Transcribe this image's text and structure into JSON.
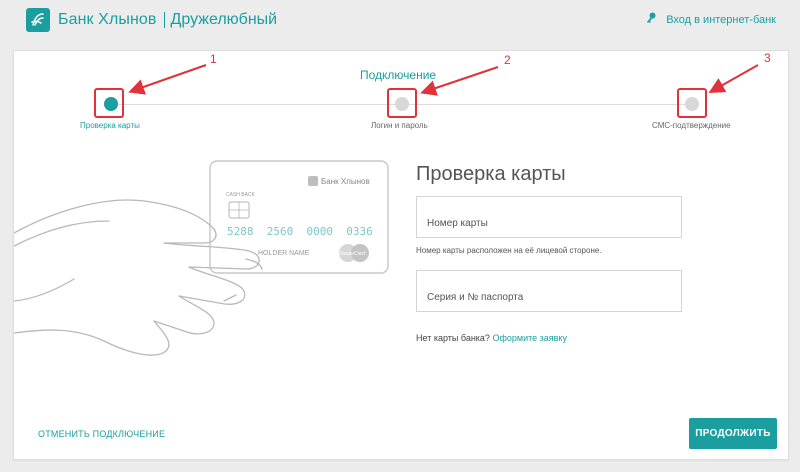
{
  "header": {
    "bank_name": "Банк Хлынов",
    "slogan": "Дружелюбный",
    "login_link": "Вход в интернет-банк"
  },
  "steps": {
    "title": "Подключение",
    "items": [
      {
        "label": "Проверка карты",
        "state": "active"
      },
      {
        "label": "Логин и пароль",
        "state": "inactive"
      },
      {
        "label": "СМС-подтверждение",
        "state": "inactive"
      }
    ]
  },
  "annotations": {
    "numbers": [
      "1",
      "2",
      "3"
    ]
  },
  "card": {
    "brand": "Банк Хлынов",
    "cashback": "CASH BACK",
    "number": "5288  2560  0000  0336",
    "holder": "HOLDER NAME",
    "network": "MasterCard"
  },
  "form": {
    "title": "Проверка карты",
    "card_number_placeholder": "Номер карты",
    "card_number_hint": "Номер карты расположен на её лицевой стороне.",
    "passport_placeholder": "Серия и № паспорта",
    "no_card_text": "Нет карты банка?",
    "apply_link": "Оформите заявку"
  },
  "actions": {
    "cancel_label": "ОТМЕНИТЬ ПОДКЛЮЧЕНИЕ",
    "continue_label": "ПРОДОЛЖИТЬ"
  },
  "colors": {
    "accent": "#1a9ea0",
    "annotation": "#e0323a"
  }
}
